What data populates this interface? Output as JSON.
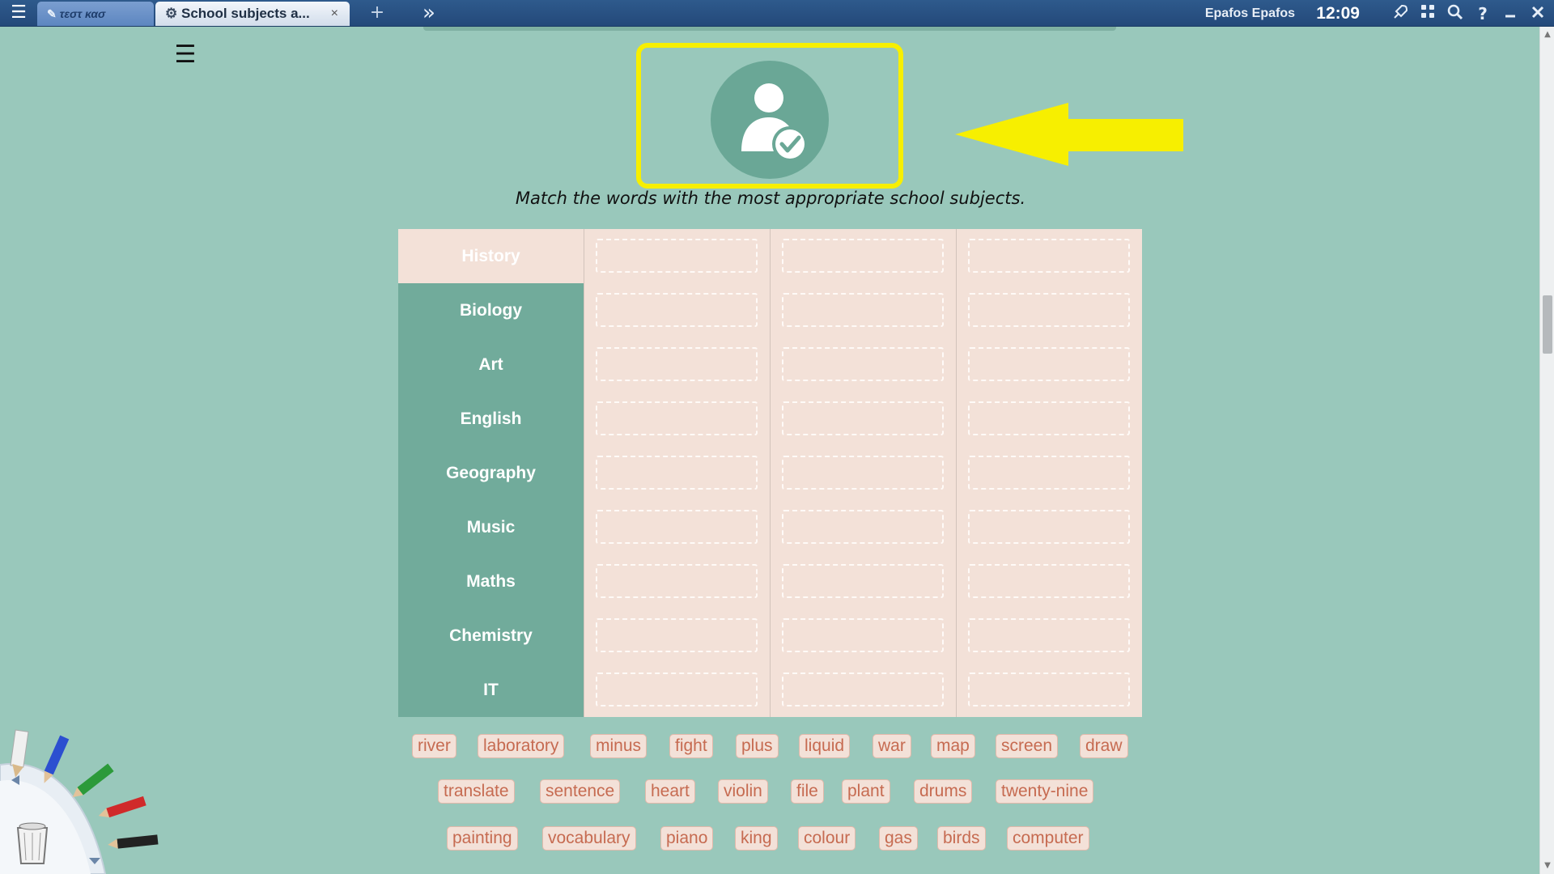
{
  "topbar": {
    "tabs": [
      {
        "label": "τεστ κασ"
      },
      {
        "label": "School subjects a...",
        "close": "×"
      }
    ],
    "add_tab": "+",
    "user": "Epafos Epafos",
    "time": "12:09"
  },
  "main": {
    "instruction": "Match the words with the most appropriate school subjects.",
    "subjects": [
      {
        "name": "History"
      },
      {
        "name": "Biology"
      },
      {
        "name": "Art"
      },
      {
        "name": "English"
      },
      {
        "name": "Geography"
      },
      {
        "name": "Music"
      },
      {
        "name": "Maths"
      },
      {
        "name": "Chemistry"
      },
      {
        "name": "IT"
      }
    ],
    "word_rows": [
      [
        "river",
        "laboratory",
        "minus",
        "fight",
        "plus",
        "liquid",
        "war",
        "map",
        "screen",
        "draw"
      ],
      [
        "translate",
        "sentence",
        "heart",
        "violin",
        "file",
        "plant",
        "drums",
        "twenty-nine"
      ],
      [
        "painting",
        "vocabulary",
        "piano",
        "king",
        "colour",
        "gas",
        "birds",
        "computer"
      ]
    ]
  },
  "colors": {
    "background": "#99c8bb",
    "subject_header": "#71ab9b",
    "drop_cell": "#f3e1d8",
    "word_text": "#c66b51",
    "highlight": "#f7ef00"
  },
  "icons": [
    "menu-icon",
    "pen-icon",
    "gear-icon",
    "forward-icon",
    "rocket-icon",
    "apps-icon",
    "search-icon",
    "help-icon",
    "minimize-icon",
    "popout-icon",
    "close-icon",
    "user-check-icon",
    "arrow-icon",
    "hamburger-icon",
    "pencil-icon",
    "trash-icon"
  ]
}
